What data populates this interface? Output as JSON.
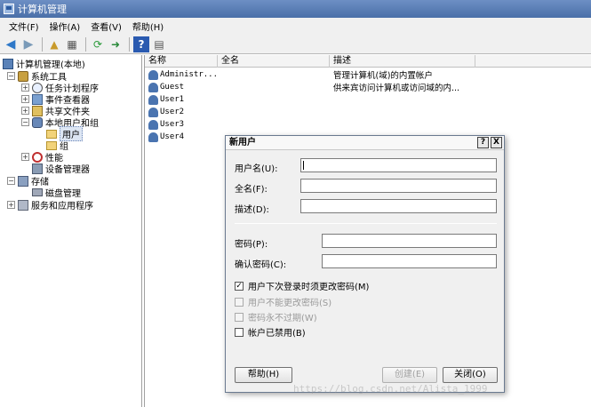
{
  "window": {
    "title": "计算机管理"
  },
  "menu": [
    "文件(F)",
    "操作(A)",
    "查看(V)",
    "帮助(H)"
  ],
  "tree": {
    "root": "计算机管理(本地)",
    "system_tools": "系统工具",
    "task_scheduler": "任务计划程序",
    "event_viewer": "事件查看器",
    "shared_folders": "共享文件夹",
    "local_users_groups": "本地用户和组",
    "users": "用户",
    "groups": "组",
    "performance": "性能",
    "device_manager": "设备管理器",
    "storage": "存储",
    "disk_management": "磁盘管理",
    "services_apps": "服务和应用程序"
  },
  "list": {
    "columns": [
      "名称",
      "全名",
      "描述"
    ],
    "rows": [
      {
        "name": "Administr...",
        "desc": "管理计算机(域)的内置帐户"
      },
      {
        "name": "Guest",
        "desc": "供来宾访问计算机或访问域的内..."
      },
      {
        "name": "User1",
        "desc": ""
      },
      {
        "name": "User2",
        "desc": ""
      },
      {
        "name": "User3",
        "desc": ""
      },
      {
        "name": "User4",
        "desc": ""
      }
    ]
  },
  "dialog": {
    "title": "新用户",
    "help_btn": "?",
    "close_btn": "X",
    "username_label": "用户名(U):",
    "fullname_label": "全名(F):",
    "description_label": "描述(D):",
    "password_label": "密码(P):",
    "confirm_label": "确认密码(C):",
    "cb_must_change": "用户下次登录时须更改密码(M)",
    "cb_cannot_change": "用户不能更改密码(S)",
    "cb_never_expires": "密码永不过期(W)",
    "cb_disabled": "帐户已禁用(B)",
    "btn_help": "帮助(H)",
    "btn_create": "创建(E)",
    "btn_close": "关闭(O)"
  },
  "watermark": "https://blog.csdn.net/Alista_1999"
}
